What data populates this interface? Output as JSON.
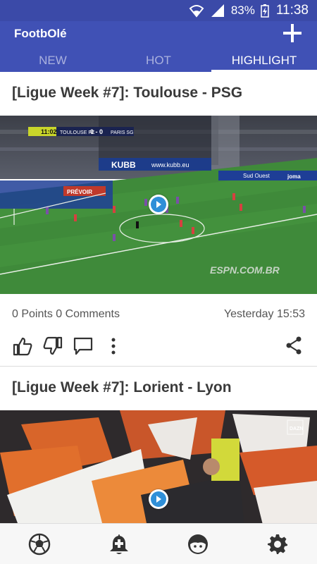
{
  "status_bar": {
    "battery": "83%",
    "time": "11:38"
  },
  "app": {
    "title": "FootbOlé"
  },
  "tabs": [
    {
      "label": "NEW"
    },
    {
      "label": "HOT"
    },
    {
      "label": "HIGHLIGHT"
    }
  ],
  "posts": [
    {
      "title": "[Ligue Week #7]: Toulouse - PSG",
      "points": "0 Points 0 Comments",
      "time": "Yesterday 15:53",
      "video": {
        "scoreboard_time": "11:02",
        "home": "TOULOUSE FC",
        "score": "0 - 0",
        "away": "PARIS SG",
        "watermark": "ESPN.COM.BR",
        "banner_sponsor": "KUBB",
        "banner_url": "www.kubb.eu",
        "ad_1": "PRÉVOIR",
        "ad_2": "Sud Ouest",
        "ad_3": "joma"
      }
    },
    {
      "title": "[Ligue Week #7]: Lorient - Lyon",
      "video": {
        "watermark": "DAZN"
      }
    }
  ],
  "colors": {
    "primary": "#4051b5",
    "status_bar": "#3b4aa8",
    "play_accent": "#2f8fd8"
  }
}
